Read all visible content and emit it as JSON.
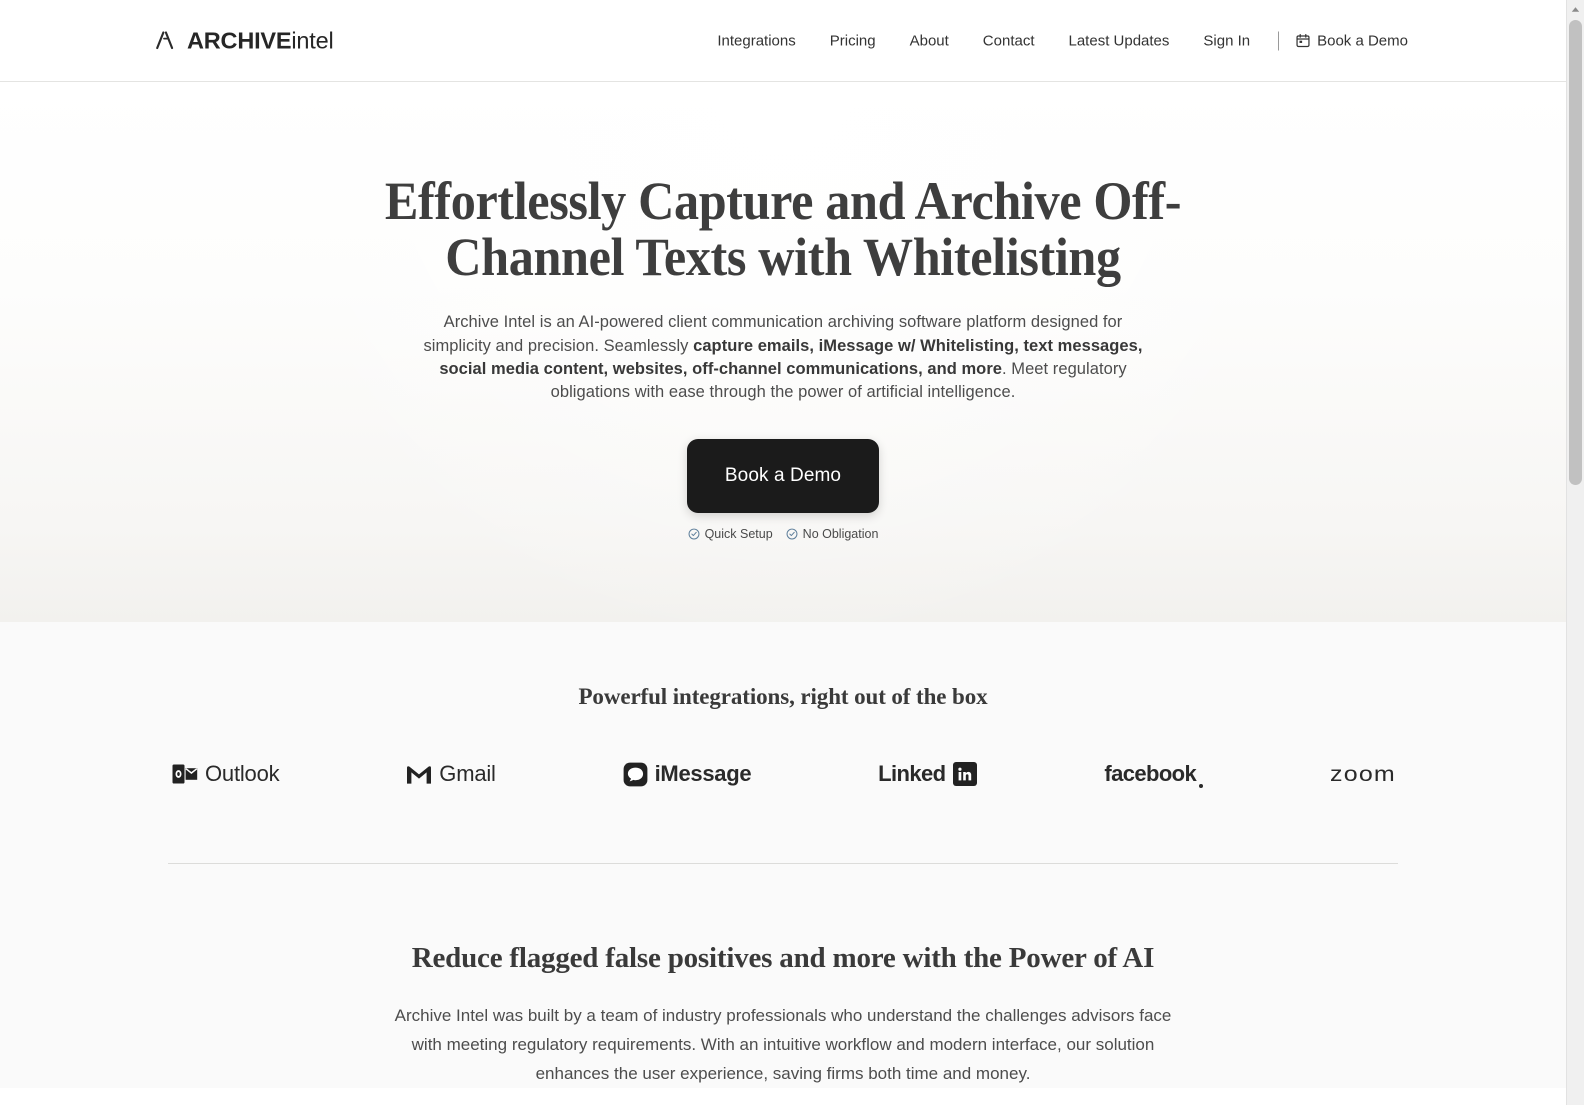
{
  "header": {
    "brand": {
      "strong": "ARCHIVE",
      "light": "intel",
      "mark_icon": "archive-a-mark-icon"
    },
    "nav": [
      {
        "label": "Integrations"
      },
      {
        "label": "Pricing"
      },
      {
        "label": "About"
      },
      {
        "label": "Contact"
      },
      {
        "label": "Latest Updates"
      },
      {
        "label": "Sign In"
      }
    ],
    "cta": {
      "label": "Book a Demo",
      "icon": "calendar-icon"
    }
  },
  "hero": {
    "title": "Effortlessly Capture and Archive Off-Channel Texts with Whitelisting",
    "sub_part1": "Archive Intel is an AI-powered client communication archiving software platform designed for simplicity and precision.  Seamlessly ",
    "sub_bold": "capture emails, iMessage w/ Whitelisting, text messages, social media content, websites, off-channel communications, and more",
    "sub_part2": ". Meet regulatory obligations with ease through the power of artificial intelligence.",
    "cta_label": "Book a Demo",
    "trust": [
      {
        "label": "Quick Setup",
        "icon": "check-circle-icon"
      },
      {
        "label": "No Obligation",
        "icon": "check-circle-icon"
      }
    ]
  },
  "integrations": {
    "heading": "Powerful integrations, right out of the box",
    "logos": [
      {
        "name": "Outlook",
        "icon": "outlook-icon"
      },
      {
        "name": "Gmail",
        "icon": "gmail-m-icon"
      },
      {
        "name": "iMessage",
        "icon": "imessage-bubble-icon"
      },
      {
        "name": "Linked",
        "icon": "linkedin-in-icon",
        "suffix": "in"
      },
      {
        "name": "facebook",
        "icon": "facebook-wordmark"
      },
      {
        "name": "zoom",
        "icon": "zoom-wordmark"
      }
    ]
  },
  "ai_section": {
    "heading": "Reduce flagged false positives and more with the Power of AI",
    "body": "Archive Intel was built by a team of industry professionals who understand the challenges advisors face with meeting regulatory requirements. With an intuitive workflow and modern interface, our solution enhances the user experience, saving firms both time and money."
  },
  "colors": {
    "accent_dark": "#1b1b1b",
    "text": "#3d3d3d",
    "check_blue": "#5b7c99",
    "hero_bg": "#fbfbfa",
    "section_bg": "#fafafa"
  }
}
